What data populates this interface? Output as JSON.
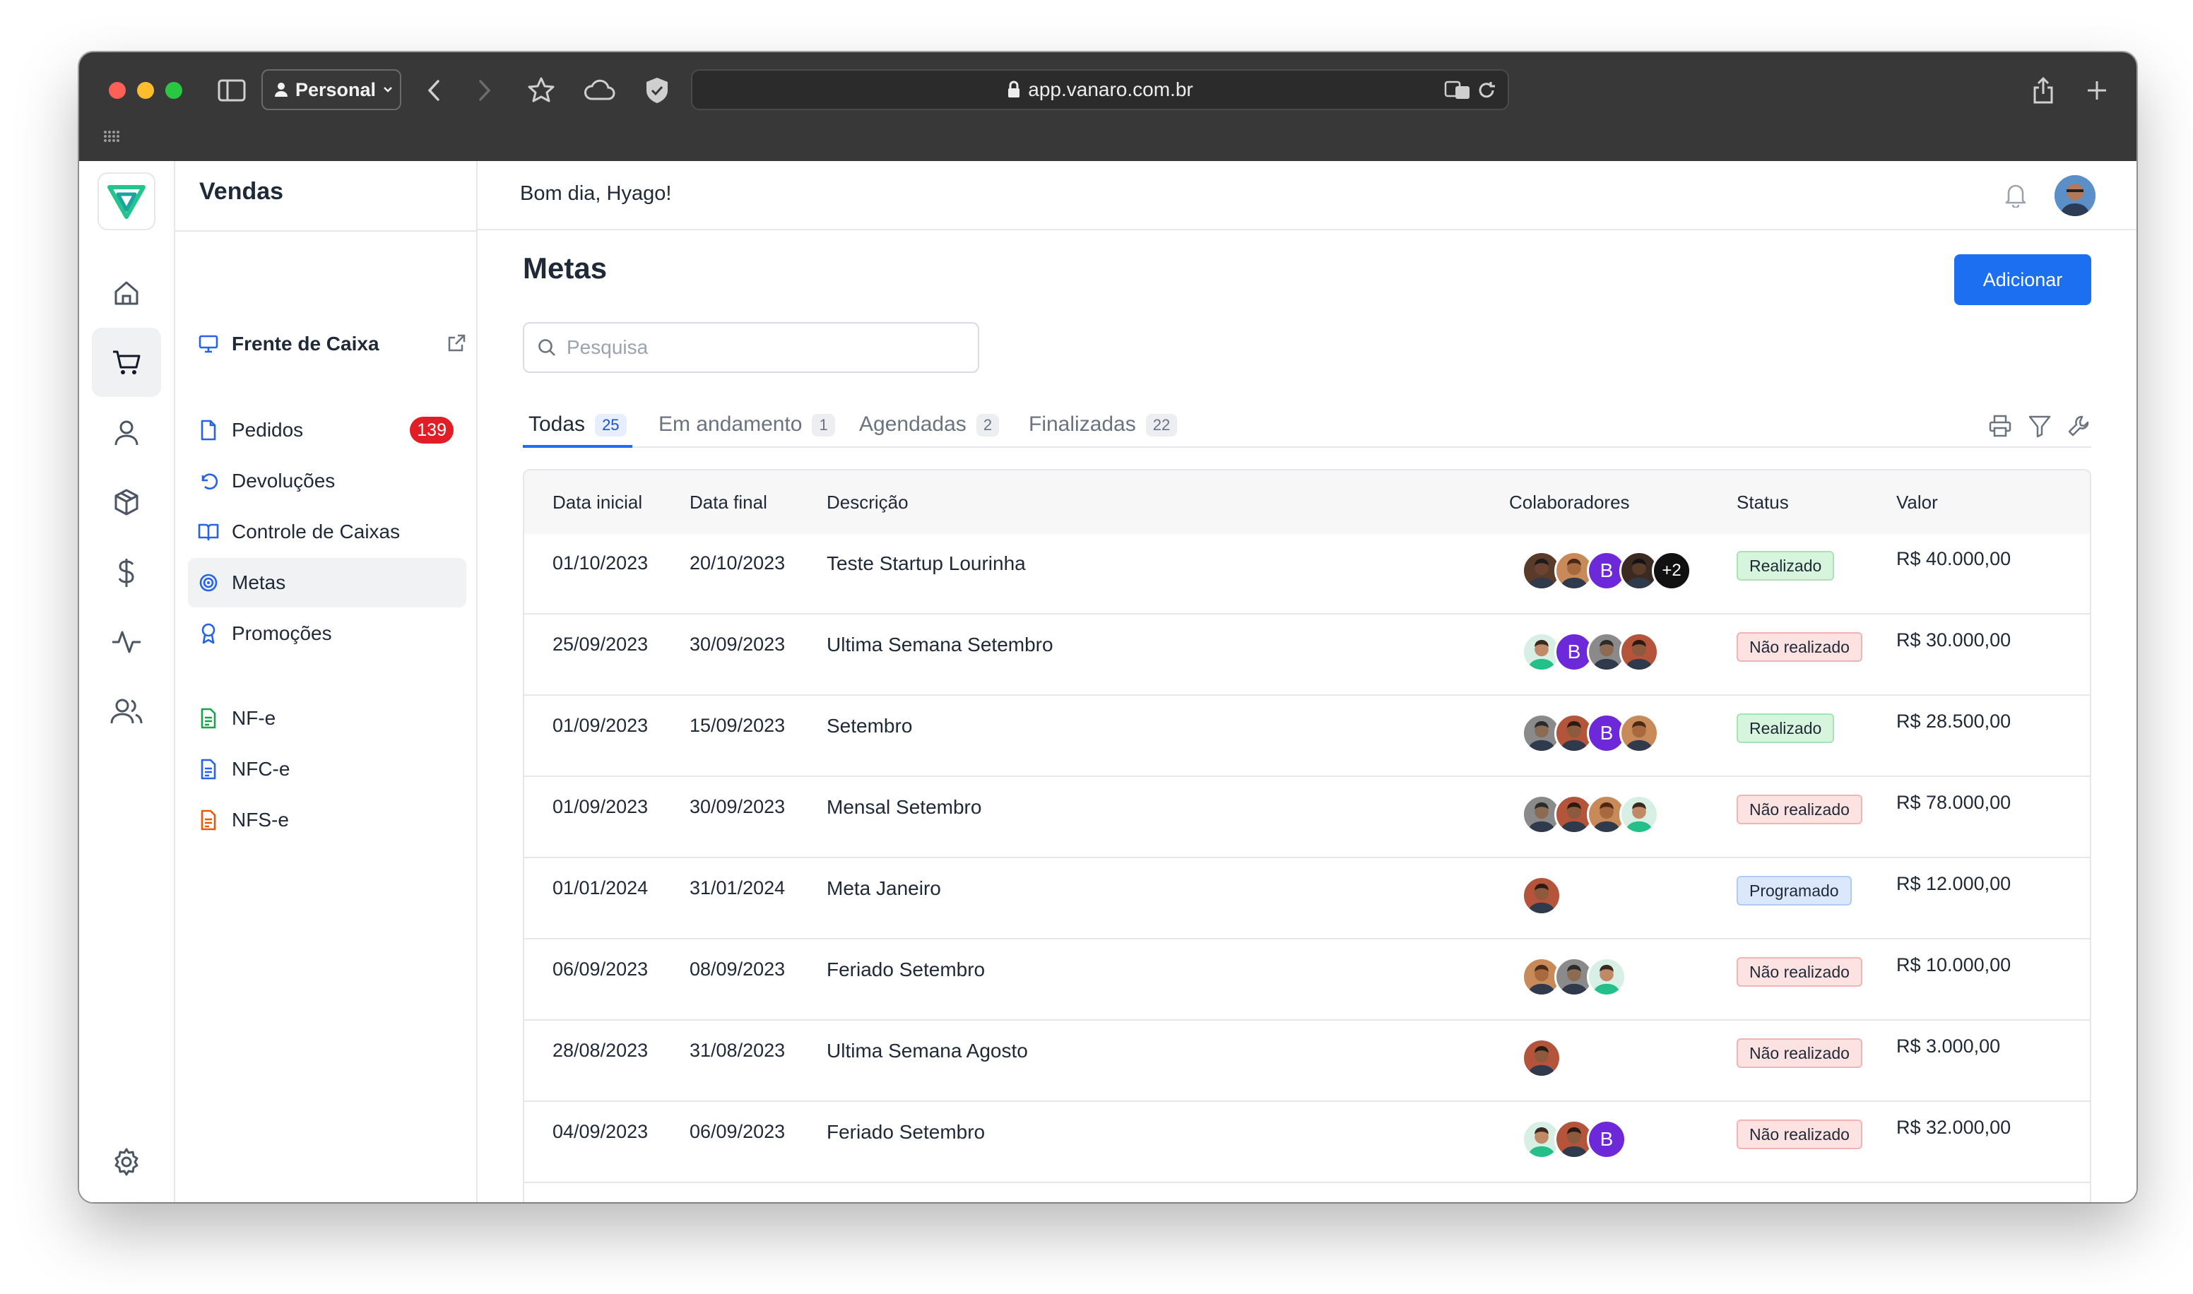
{
  "browser": {
    "profile_label": "Personal",
    "url": "app.vanaro.com.br"
  },
  "sidebar": {
    "section_title": "Vendas",
    "items": [
      {
        "label": "Frente de Caixa",
        "icon": "monitor-icon",
        "color": "#2563eb"
      },
      {
        "label": "Pedidos",
        "icon": "file-icon",
        "color": "#2563eb",
        "badge": "139"
      },
      {
        "label": "Devoluções",
        "icon": "undo-icon",
        "color": "#2563eb"
      },
      {
        "label": "Controle de Caixas",
        "icon": "book-icon",
        "color": "#2563eb"
      },
      {
        "label": "Metas",
        "icon": "target-icon",
        "color": "#2563eb",
        "active": true
      },
      {
        "label": "Promoções",
        "icon": "award-icon",
        "color": "#2563eb"
      },
      {
        "label": "NF-e",
        "icon": "doc-green-icon",
        "color": "#16a34a"
      },
      {
        "label": "NFC-e",
        "icon": "doc-blue-icon",
        "color": "#2563eb"
      },
      {
        "label": "NFS-e",
        "icon": "doc-orange-icon",
        "color": "#ea580c"
      }
    ]
  },
  "header": {
    "greeting": "Bom dia, Hyago!"
  },
  "page": {
    "title": "Metas",
    "add_label": "Adicionar",
    "search_placeholder": "Pesquisa",
    "tabs": [
      {
        "label": "Todas",
        "count": "25",
        "active": true
      },
      {
        "label": "Em andamento",
        "count": "1"
      },
      {
        "label": "Agendadas",
        "count": "2"
      },
      {
        "label": "Finalizadas",
        "count": "22"
      }
    ]
  },
  "table": {
    "columns": [
      "Data inicial",
      "Data final",
      "Descrição",
      "Colaboradores",
      "Status",
      "Valor"
    ],
    "rows": [
      {
        "start": "01/10/2023",
        "end": "20/10/2023",
        "desc": "Teste Startup Lourinha",
        "collab": [
          "dark",
          "curly",
          "B",
          "dark2",
          "+2"
        ],
        "status": "Realizado",
        "value": "R$ 40.000,00"
      },
      {
        "start": "25/09/2023",
        "end": "30/09/2023",
        "desc": "Ultima Semana Setembro",
        "collab": [
          "green",
          "B",
          "glasses",
          "brown"
        ],
        "status": "Não realizado",
        "value": "R$ 30.000,00"
      },
      {
        "start": "01/09/2023",
        "end": "15/09/2023",
        "desc": "Setembro",
        "collab": [
          "glasses",
          "brown",
          "B",
          "curly"
        ],
        "status": "Realizado",
        "value": "R$ 28.500,00"
      },
      {
        "start": "01/09/2023",
        "end": "30/09/2023",
        "desc": "Mensal Setembro",
        "collab": [
          "glasses",
          "brown",
          "curly",
          "green"
        ],
        "status": "Não realizado",
        "value": "R$ 78.000,00"
      },
      {
        "start": "01/01/2024",
        "end": "31/01/2024",
        "desc": "Meta Janeiro",
        "collab": [
          "brown"
        ],
        "status": "Programado",
        "value": "R$ 12.000,00"
      },
      {
        "start": "06/09/2023",
        "end": "08/09/2023",
        "desc": "Feriado Setembro",
        "collab": [
          "curly",
          "glasses",
          "green"
        ],
        "status": "Não realizado",
        "value": "R$ 10.000,00"
      },
      {
        "start": "28/08/2023",
        "end": "31/08/2023",
        "desc": "Ultima Semana Agosto",
        "collab": [
          "brown"
        ],
        "status": "Não realizado",
        "value": "R$ 3.000,00"
      },
      {
        "start": "04/09/2023",
        "end": "06/09/2023",
        "desc": "Feriado Setembro",
        "collab": [
          "green",
          "brown",
          "B"
        ],
        "status": "Não realizado",
        "value": "R$ 32.000,00"
      }
    ]
  },
  "colors": {
    "primary": "#1d6ff2",
    "badge_red": "#e11d26",
    "realizado": "#d6f5dc",
    "nao_realizado": "#fde2e2",
    "programado": "#dbe8fb"
  }
}
